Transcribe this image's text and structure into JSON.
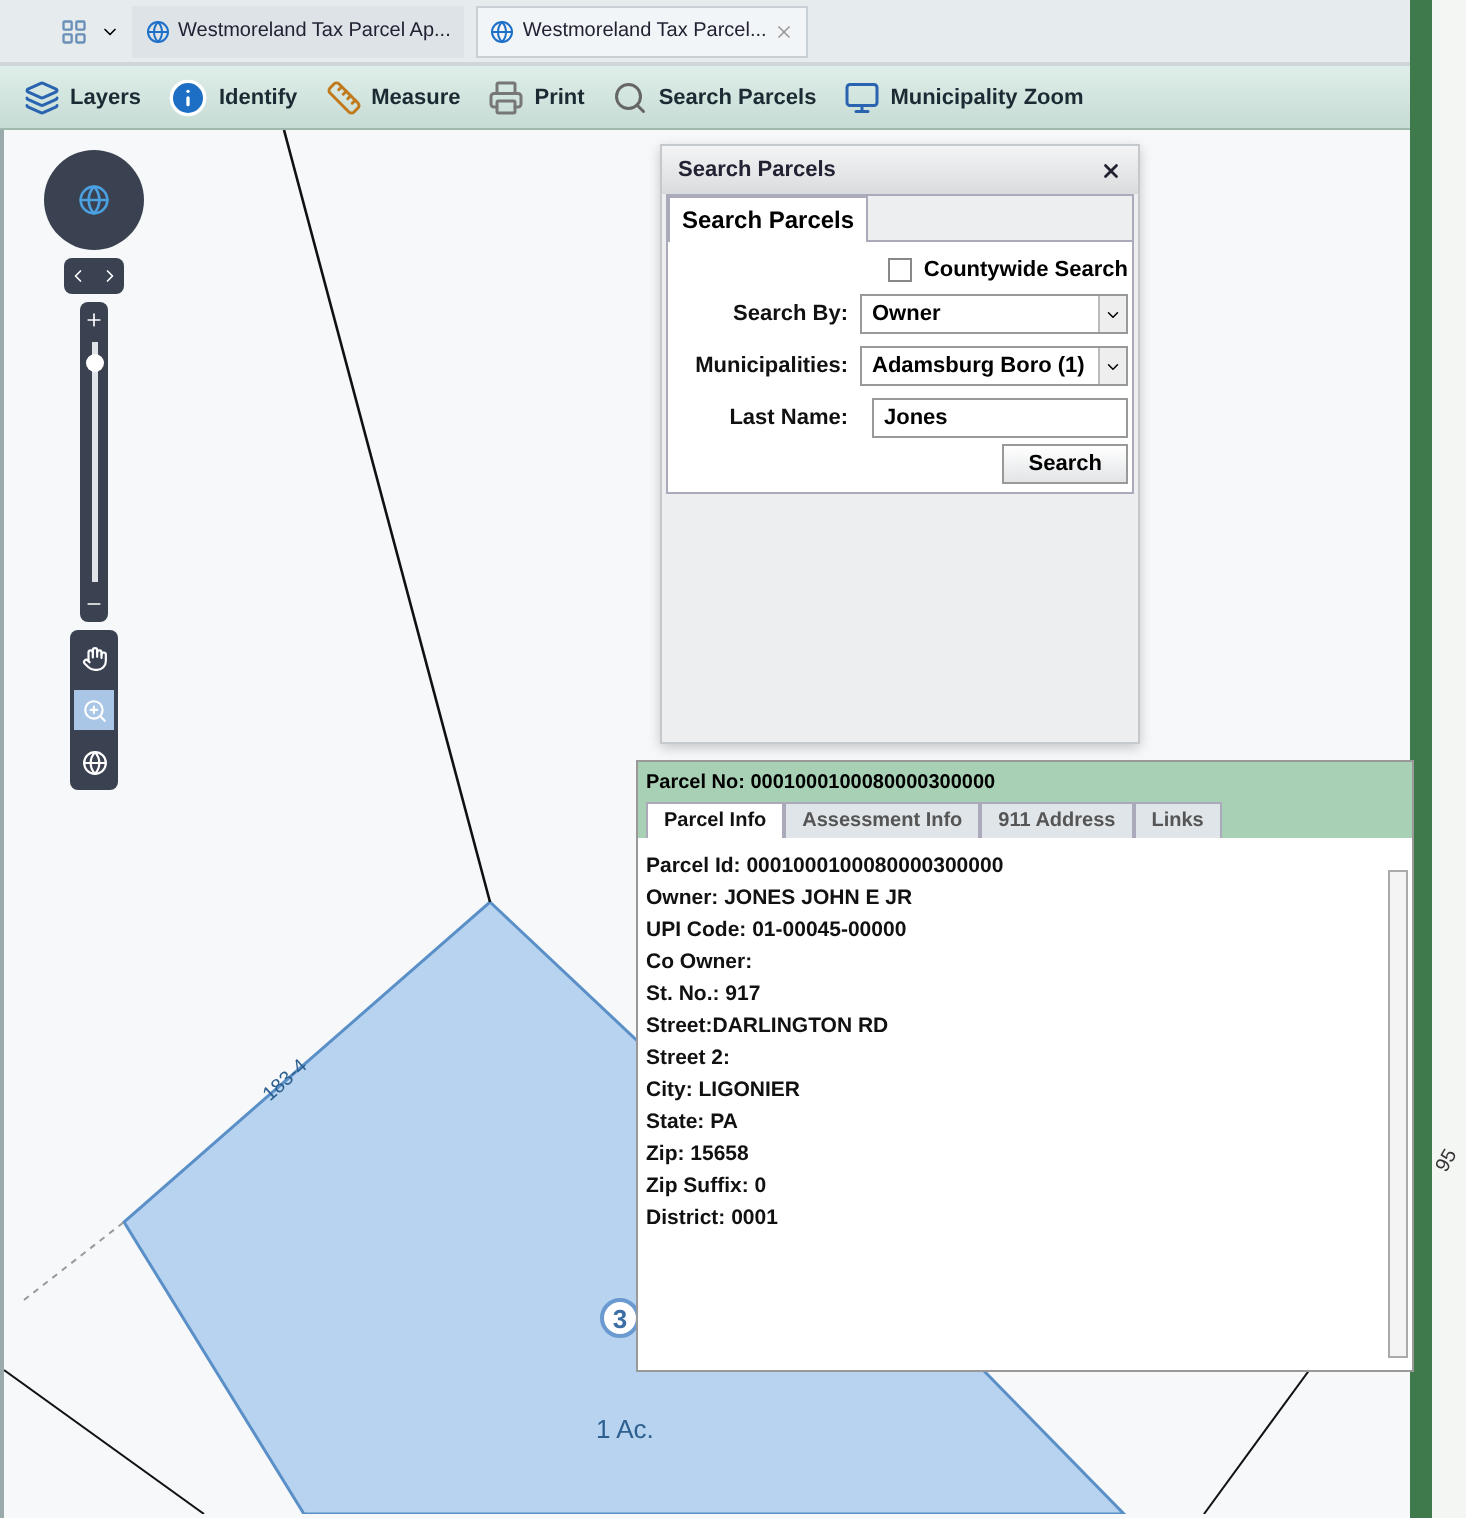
{
  "browser_tabs": [
    {
      "label": "Westmoreland Tax Parcel Ap...",
      "selected": false,
      "closable": false
    },
    {
      "label": "Westmoreland Tax Parcel...",
      "selected": true,
      "closable": true
    }
  ],
  "toolbar": [
    {
      "kind": "layers",
      "label": "Layers"
    },
    {
      "kind": "identify",
      "label": "Identify"
    },
    {
      "kind": "measure",
      "label": "Measure"
    },
    {
      "kind": "print",
      "label": "Print"
    },
    {
      "kind": "search",
      "label": "Search Parcels"
    },
    {
      "kind": "zoom",
      "label": "Municipality Zoom"
    }
  ],
  "map": {
    "zoom_slider": {
      "level": 0.95
    },
    "tools": [
      {
        "kind": "pan",
        "selected": false
      },
      {
        "kind": "zoom",
        "selected": true
      },
      {
        "kind": "globe",
        "selected": false
      }
    ],
    "labels": [
      {
        "kind": "lot",
        "text": "183-4"
      },
      {
        "kind": "marker",
        "text": "3"
      },
      {
        "kind": "area",
        "text": "1 Ac."
      }
    ]
  },
  "edge_strip": {
    "label": "95"
  },
  "search_dialog": {
    "title": "Search Parcels",
    "tabs": [
      {
        "label": "Search Parcels",
        "selected": true
      }
    ],
    "countywide": {
      "label": "Countywide Search",
      "checked": false
    },
    "fields": [
      {
        "kind": "select",
        "label": "Search By:",
        "value": "Owner"
      },
      {
        "kind": "select",
        "label": "Municipalities:",
        "value": "Adamsburg Boro (1)"
      },
      {
        "kind": "text",
        "label": "Last Name:",
        "value": "Jones"
      }
    ],
    "button": "Search"
  },
  "parcel_panel": {
    "title": "Parcel No: 0001000100080000300000",
    "tabs": [
      {
        "label": "Parcel Info",
        "selected": true
      },
      {
        "label": "Assessment Info",
        "selected": false
      },
      {
        "label": "911 Address",
        "selected": false
      },
      {
        "label": "Links",
        "selected": false
      }
    ],
    "lines": [
      "Parcel Id: 0001000100080000300000",
      "Owner: JONES JOHN E JR",
      "UPI Code: 01-00045-00000",
      "Co Owner:",
      "St. No.: 917",
      "Street:DARLINGTON RD",
      "Street 2:",
      "City: LIGONIER",
      "State: PA",
      "Zip: 15658",
      "Zip Suffix: 0",
      "District: 0001"
    ]
  }
}
